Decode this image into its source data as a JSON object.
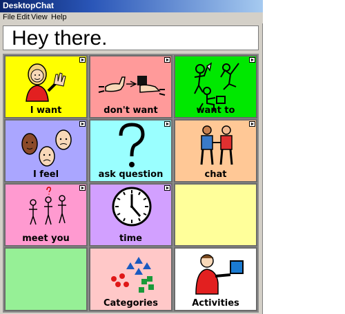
{
  "window": {
    "title": "DesktopChat"
  },
  "menu": [
    "File",
    "Edit",
    "View",
    "Help"
  ],
  "message": {
    "text": "Hey there."
  },
  "cells": [
    {
      "label": "I want",
      "color": "#ffff00"
    },
    {
      "label": "don't want",
      "color": "#ff9a9a"
    },
    {
      "label": "want to",
      "color": "#00e800"
    },
    {
      "label": "I feel",
      "color": "#aaa6ff"
    },
    {
      "label": "ask question",
      "color": "#9affff"
    },
    {
      "label": "chat",
      "color": "#ffc896"
    },
    {
      "label": "meet you",
      "color": "#ff9ad0"
    },
    {
      "label": "time",
      "color": "#d2a0ff"
    },
    {
      "label": "",
      "color": "#ffff9a"
    },
    {
      "label": "",
      "color": "#96f096"
    },
    {
      "label": "Categories",
      "color": "#ffc8c8"
    },
    {
      "label": "Activities",
      "color": "#ffffff"
    }
  ]
}
